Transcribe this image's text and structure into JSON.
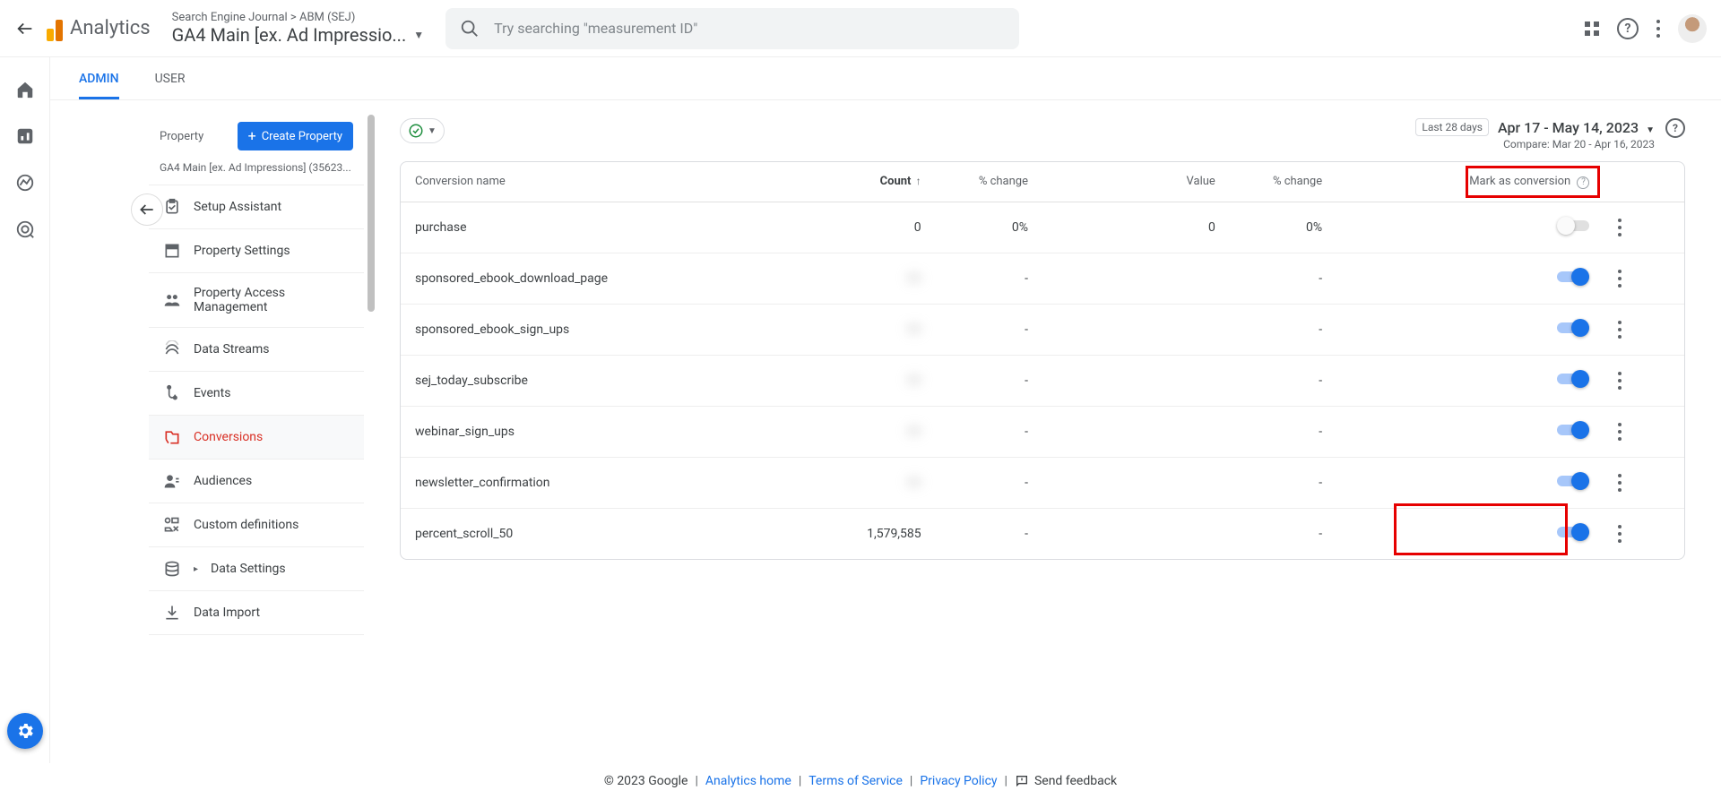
{
  "header": {
    "product": "Analytics",
    "breadcrumb": "Search Engine Journal > ABM (SEJ)",
    "property_selector": "GA4 Main [ex. Ad Impressio...",
    "search_placeholder": "Try searching \"measurement ID\""
  },
  "tabs": {
    "admin": "ADMIN",
    "user": "USER"
  },
  "sidebar": {
    "property_label": "Property",
    "create_btn": "Create Property",
    "property_id": "GA4 Main [ex. Ad Impressions] (35623...",
    "items": [
      {
        "label": "Setup Assistant"
      },
      {
        "label": "Property Settings"
      },
      {
        "label": "Property Access Management"
      },
      {
        "label": "Data Streams"
      },
      {
        "label": "Events"
      },
      {
        "label": "Conversions"
      },
      {
        "label": "Audiences"
      },
      {
        "label": "Custom definitions"
      },
      {
        "label": "Data Settings",
        "chevron": true
      },
      {
        "label": "Data Import"
      }
    ],
    "active_index": 5
  },
  "date": {
    "chip": "Last 28 days",
    "range": "Apr 17 - May 14, 2023",
    "compare": "Compare: Mar 20 - Apr 16, 2023"
  },
  "table": {
    "cols": {
      "name": "Conversion name",
      "count": "Count",
      "count_change": "% change",
      "value": "Value",
      "value_change": "% change",
      "mark": "Mark as conversion"
    },
    "rows": [
      {
        "name": "purchase",
        "count": "0",
        "count_change": "0%",
        "value": "0",
        "value_change": "0%",
        "on": false
      },
      {
        "name": "sponsored_ebook_download_page",
        "count": "",
        "count_change": "-",
        "value": "",
        "value_change": "-",
        "on": true,
        "blur": true
      },
      {
        "name": "sponsored_ebook_sign_ups",
        "count": "",
        "count_change": "-",
        "value": "",
        "value_change": "-",
        "on": true,
        "blur": true
      },
      {
        "name": "sej_today_subscribe",
        "count": "",
        "count_change": "-",
        "value": "",
        "value_change": "-",
        "on": true,
        "blur": true
      },
      {
        "name": "webinar_sign_ups",
        "count": "",
        "count_change": "-",
        "value": "",
        "value_change": "-",
        "on": true,
        "blur": true
      },
      {
        "name": "newsletter_confirmation",
        "count": "",
        "count_change": "-",
        "value": "",
        "value_change": "-",
        "on": true,
        "blur": true
      },
      {
        "name": "percent_scroll_50",
        "count": "1,579,585",
        "count_change": "-",
        "value": "",
        "value_change": "-",
        "on": true
      }
    ]
  },
  "footer": {
    "copyright": "© 2023 Google",
    "home": "Analytics home",
    "tos": "Terms of Service",
    "privacy": "Privacy Policy",
    "feedback": "Send feedback"
  }
}
